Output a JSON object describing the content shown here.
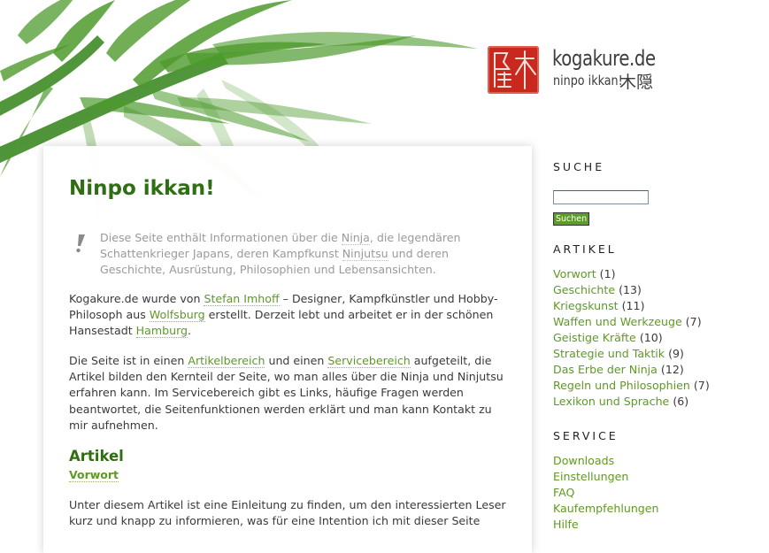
{
  "header": {
    "site_name": "kogakure.de",
    "tagline": "ninpo ikkan!",
    "kanji": "木隠",
    "seal_text": "隱木"
  },
  "main": {
    "title": "Ninpo ikkan!",
    "intro": {
      "t1": "Diese Seite enthält Informationen über die ",
      "l1": "Ninja",
      "t2": ", die legendären Schattenkrieger Japans, deren Kampfkunst ",
      "l2": "Ninjutsu",
      "t3": " und deren Geschichte, Ausrüstung, Philosophien und Lebensansichten."
    },
    "para1": {
      "t1": "Kogakure.de wurde von ",
      "l1": "Stefan Imhoff",
      "t2": " – Designer, Kampfkünstler und Hobby-Philosoph aus ",
      "l2": "Wolfsburg",
      "t3": " erstellt. Derzeit lebt und arbeitet er in der schönen Hansestadt ",
      "l3": "Hamburg",
      "t4": "."
    },
    "para2": {
      "t1": "Die Seite ist in einen ",
      "l1": "Artikelbereich",
      "t2": " und einen ",
      "l2": "Servicebereich",
      "t3": " aufgeteilt, die Artikel bilden den Kernteil der Seite, wo man alles über die Ninja und Ninjutsu erfahren kann. Im Servicebereich gibt es Links, häufige Fragen werden beantwortet, die Seitenfunktionen werden erklärt und man kann Kontakt zu mir aufnehmen."
    },
    "section_heading": "Artikel",
    "section_link": "Vorwort",
    "para3": "Unter diesem Artikel ist eine Einleitung zu finden, um den interessierten Leser kurz und knapp zu informieren, was für eine Intention ich mit dieser Seite"
  },
  "sidebar": {
    "search_heading": "SUCHE",
    "search_value": "",
    "search_button": "Suchen",
    "articles_heading": "ARTIKEL",
    "articles": [
      {
        "label": "Vorwort",
        "count": "(1)"
      },
      {
        "label": "Geschichte",
        "count": "(13)"
      },
      {
        "label": "Kriegskunst",
        "count": "(11)"
      },
      {
        "label": "Waffen und Werkzeuge",
        "count": "(7)"
      },
      {
        "label": "Geistige Kräfte",
        "count": "(10)"
      },
      {
        "label": "Strategie und Taktik",
        "count": "(9)"
      },
      {
        "label": "Das Erbe der Ninja",
        "count": "(12)"
      },
      {
        "label": "Regeln und Philosophien",
        "count": "(7)"
      },
      {
        "label": "Lexikon und Sprache",
        "count": "(6)"
      }
    ],
    "service_heading": "SERVICE",
    "services": [
      "Downloads",
      "Einstellungen",
      "FAQ",
      "Kaufempfehlungen",
      "Hilfe"
    ]
  },
  "colors": {
    "accent_green": "#5e9a22",
    "heading_green": "#2f6e12",
    "seal_red": "#c8281e"
  }
}
